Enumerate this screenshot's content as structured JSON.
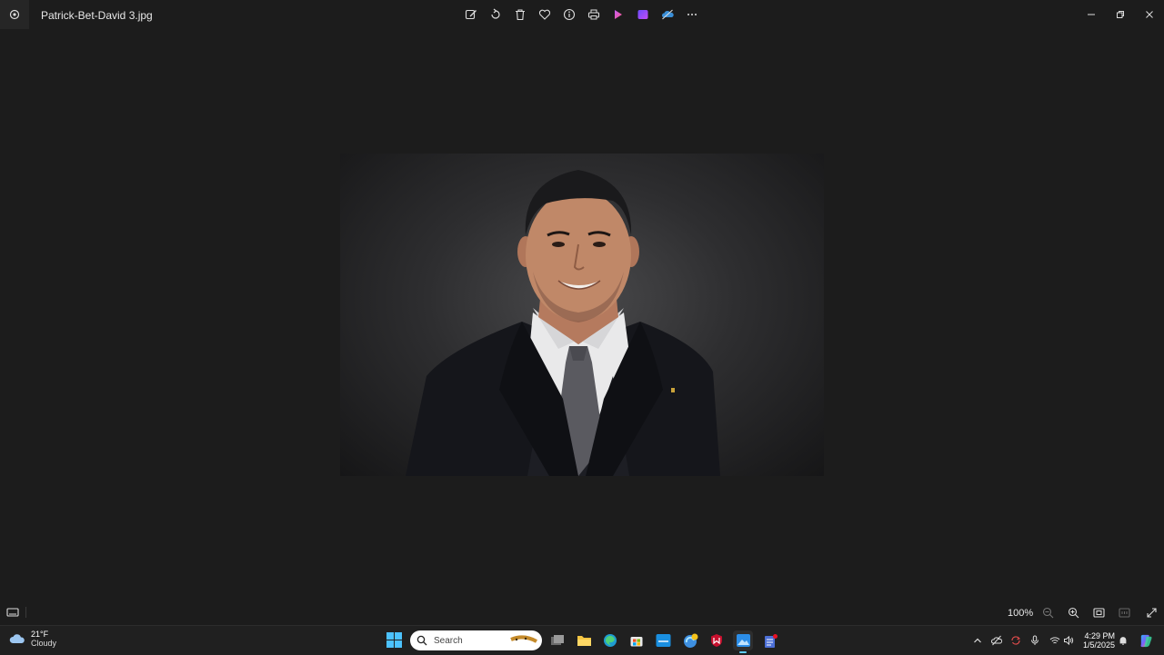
{
  "window": {
    "title": "Patrick-Bet-David 3.jpg",
    "app_icon": "photos-app-icon",
    "toolbar": [
      {
        "icon": "edit-image-icon"
      },
      {
        "icon": "rotate-icon"
      },
      {
        "icon": "delete-icon"
      },
      {
        "icon": "favorite-heart-icon"
      },
      {
        "icon": "info-icon"
      },
      {
        "icon": "print-icon"
      },
      {
        "icon": "clipchamp-icon"
      },
      {
        "icon": "designer-icon"
      },
      {
        "icon": "onedrive-icon"
      },
      {
        "icon": "more-icon"
      }
    ],
    "controls": [
      "minimize-icon",
      "restore-icon",
      "close-icon"
    ]
  },
  "photo": {
    "subject": "portrait photograph"
  },
  "statusbar": {
    "zoom": "100%",
    "icons": [
      "filmstrip-icon",
      "zoom-out-icon",
      "zoom-in-icon",
      "fit-to-window-icon",
      "actual-size-icon",
      "fullscreen-icon"
    ]
  },
  "taskbar": {
    "weather": {
      "temp": "21°F",
      "condition": "Cloudy"
    },
    "search_placeholder": "Search",
    "apps": [
      "task-view",
      "file-explorer",
      "edge",
      "microsoft-store",
      "mylife",
      "edge-beta",
      "mcafee",
      "photos",
      "notes"
    ],
    "clock": {
      "time": "4:29 PM",
      "date": "1/5/2025"
    }
  },
  "colors": {
    "background": "#1c1c1c",
    "taskbar": "#202020",
    "accent": "#60cdff"
  }
}
